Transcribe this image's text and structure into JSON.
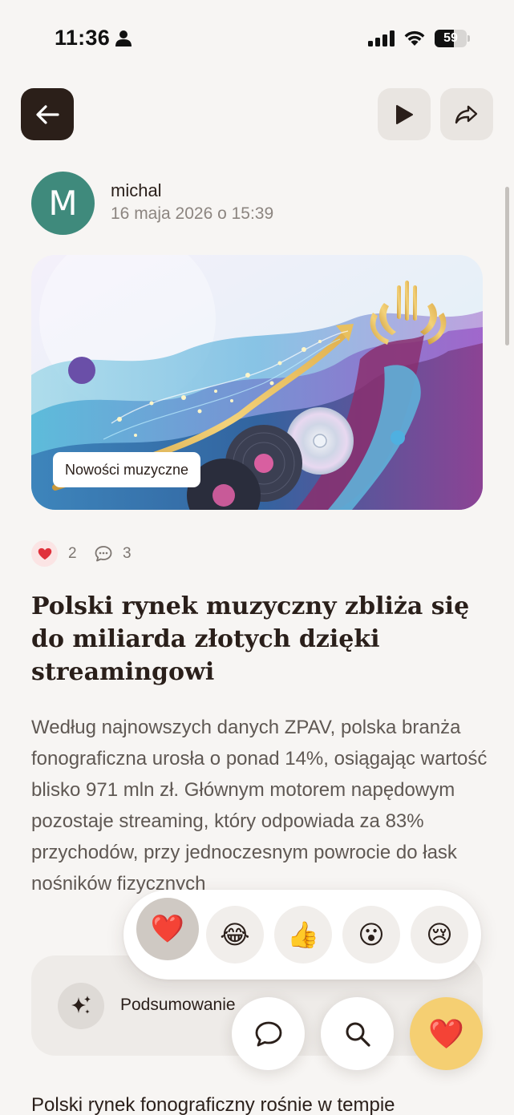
{
  "status_bar": {
    "time": "11:36",
    "battery": "59",
    "battery_level": 0.59
  },
  "toolbar": {
    "back_icon": "arrow-left-icon",
    "play_icon": "play-icon",
    "share_icon": "share-icon"
  },
  "author": {
    "initial": "M",
    "name": "michal",
    "date": "16 maja 2026 o 15:39",
    "avatar_color": "#3f8a7c"
  },
  "hero": {
    "category": "Nowości muzyczne"
  },
  "stats": {
    "likes": "2",
    "comments": "3"
  },
  "article": {
    "title": "Polski rynek muzyczny zbliża się do miliarda złotych dzięki streamingowi",
    "lead": "Według najnowszych danych ZPAV, polska branża fonograficzna urosła o ponad 14%, osiągając wartość blisko 971 mln zł. Głównym motorem napędowym pozostaje streaming, który odpowiada za 83% przychodów, przy jednoczesnym powrocie do łask nośników fizycznych",
    "body_start": "Polski rynek fonograficzny rośnie w tempie"
  },
  "summary": {
    "label": "Podsumowanie"
  },
  "reactions": [
    {
      "emoji": "❤️",
      "name": "heart",
      "selected": true
    },
    {
      "emoji": "😂",
      "name": "laugh",
      "selected": false
    },
    {
      "emoji": "👍",
      "name": "thumbs-up",
      "selected": false
    },
    {
      "emoji": "😮",
      "name": "surprised",
      "selected": false
    },
    {
      "emoji": "😢",
      "name": "sad",
      "selected": false
    }
  ],
  "fabs": {
    "react_emoji": "❤️"
  },
  "colors": {
    "background": "#f7f5f3",
    "dark_button": "#2b1f19",
    "accent": "#f5cf72"
  }
}
